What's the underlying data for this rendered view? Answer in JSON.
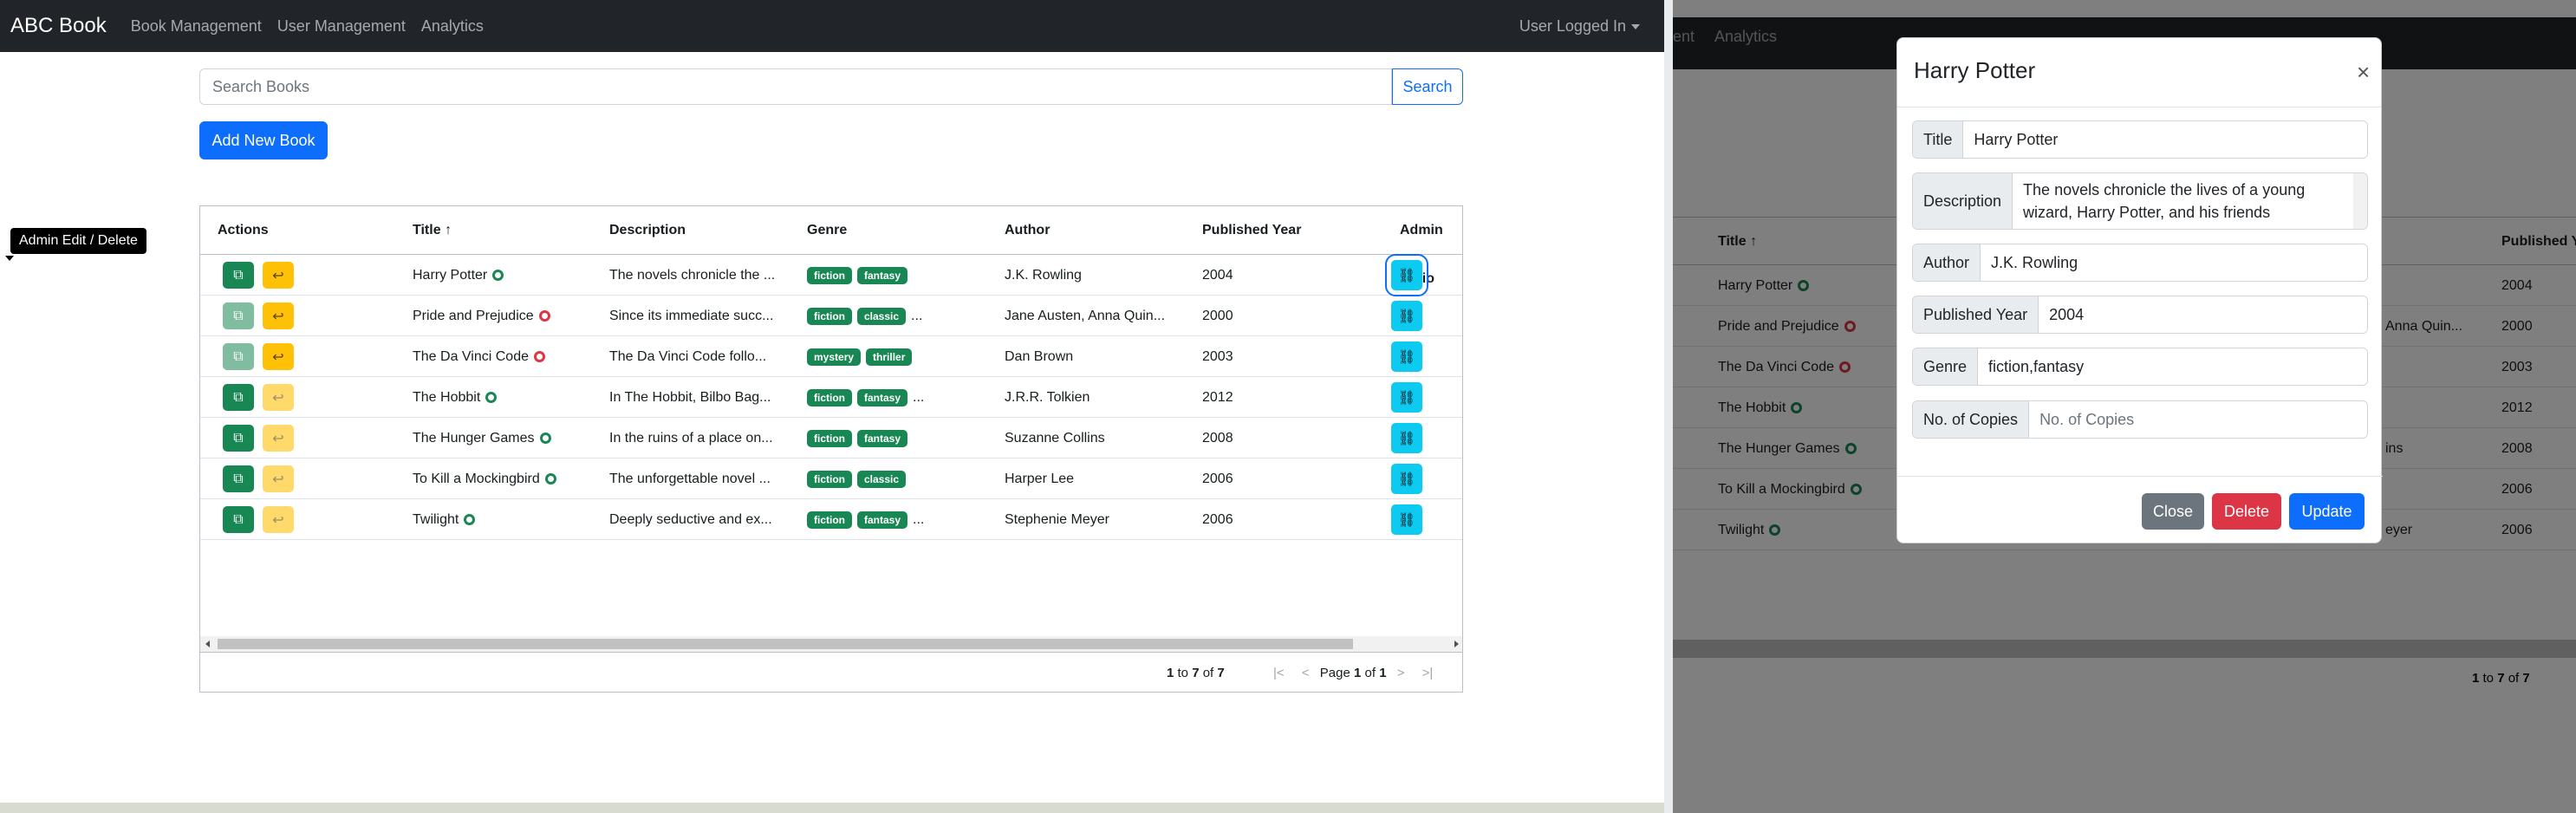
{
  "navbar": {
    "brand": "ABC Book",
    "links": [
      "Book Management",
      "User Management",
      "Analytics"
    ],
    "user_menu": "User Logged In"
  },
  "search": {
    "placeholder": "Search Books",
    "button": "Search"
  },
  "add_button": "Add New Book",
  "tooltip": "Admin Edit / Delete",
  "grid": {
    "headers": [
      "Actions",
      "Title",
      "Description",
      "Genre",
      "Author",
      "Published Year",
      "Admin Actio"
    ],
    "rows": [
      {
        "title": "Harry Potter",
        "available": true,
        "description": "The novels chronicle the ...",
        "genres": [
          "fiction",
          "fantasy"
        ],
        "more": false,
        "author": "J.K. Rowling",
        "year": "2004",
        "copy_faded": false,
        "return_faded": false
      },
      {
        "title": "Pride and Prejudice",
        "available": false,
        "description": "Since its immediate succ...",
        "genres": [
          "fiction",
          "classic"
        ],
        "more": true,
        "author": "Jane Austen, Anna Quin...",
        "year": "2000",
        "copy_faded": true,
        "return_faded": false
      },
      {
        "title": "The Da Vinci Code",
        "available": false,
        "description": "The Da Vinci Code follo...",
        "genres": [
          "mystery",
          "thriller"
        ],
        "more": false,
        "author": "Dan Brown",
        "year": "2003",
        "copy_faded": true,
        "return_faded": false
      },
      {
        "title": "The Hobbit",
        "available": true,
        "description": "In The Hobbit, Bilbo Bag...",
        "genres": [
          "fiction",
          "fantasy"
        ],
        "more": true,
        "author": "J.R.R. Tolkien",
        "year": "2012",
        "copy_faded": false,
        "return_faded": true
      },
      {
        "title": "The Hunger Games",
        "available": true,
        "description": "In the ruins of a place on...",
        "genres": [
          "fiction",
          "fantasy"
        ],
        "more": false,
        "author": "Suzanne Collins",
        "year": "2008",
        "copy_faded": false,
        "return_faded": true
      },
      {
        "title": "To Kill a Mockingbird",
        "available": true,
        "description": "The unforgettable novel ...",
        "genres": [
          "fiction",
          "classic"
        ],
        "more": false,
        "author": "Harper Lee",
        "year": "2006",
        "copy_faded": false,
        "return_faded": true
      },
      {
        "title": "Twilight",
        "available": true,
        "description": "Deeply seductive and ex...",
        "genres": [
          "fiction",
          "fantasy"
        ],
        "more": true,
        "author": "Stephenie Meyer",
        "year": "2006",
        "copy_faded": false,
        "return_faded": true
      }
    ],
    "paging_summary": {
      "from": "1",
      "to": "7",
      "total": "7",
      "to_word": "to",
      "of_word": "of"
    },
    "paging": {
      "page_word": "Page",
      "page": "1",
      "of_word": "of",
      "pages": "1"
    }
  },
  "right_panel": {
    "nav_partial": [
      "ent",
      "Analytics"
    ],
    "headers": [
      "Title",
      "Published Ye"
    ],
    "authors_partial": [
      "",
      "Anna Quin...",
      "",
      "",
      "ins",
      "",
      "eyer"
    ],
    "modal": {
      "title": "Harry Potter",
      "close_icon": "×",
      "fields": {
        "title_label": "Title",
        "title_value": "Harry Potter",
        "description_label": "Description",
        "description_value": "The novels chronicle the lives of a young wizard, Harry Potter, and his friends",
        "author_label": "Author",
        "author_value": "J.K. Rowling",
        "year_label": "Published Year",
        "year_value": "2004",
        "genre_label": "Genre",
        "genre_value": "fiction,fantasy",
        "copies_label": "No. of Copies",
        "copies_placeholder": "No. of Copies"
      },
      "buttons": {
        "close": "Close",
        "delete": "Delete",
        "update": "Update"
      }
    }
  },
  "colors": {
    "primary": "#0d6efd",
    "success": "#198754",
    "warning": "#ffc107",
    "danger": "#dc3545",
    "info": "#0dcaf0",
    "secondary": "#6c757d",
    "dark": "#212529"
  }
}
